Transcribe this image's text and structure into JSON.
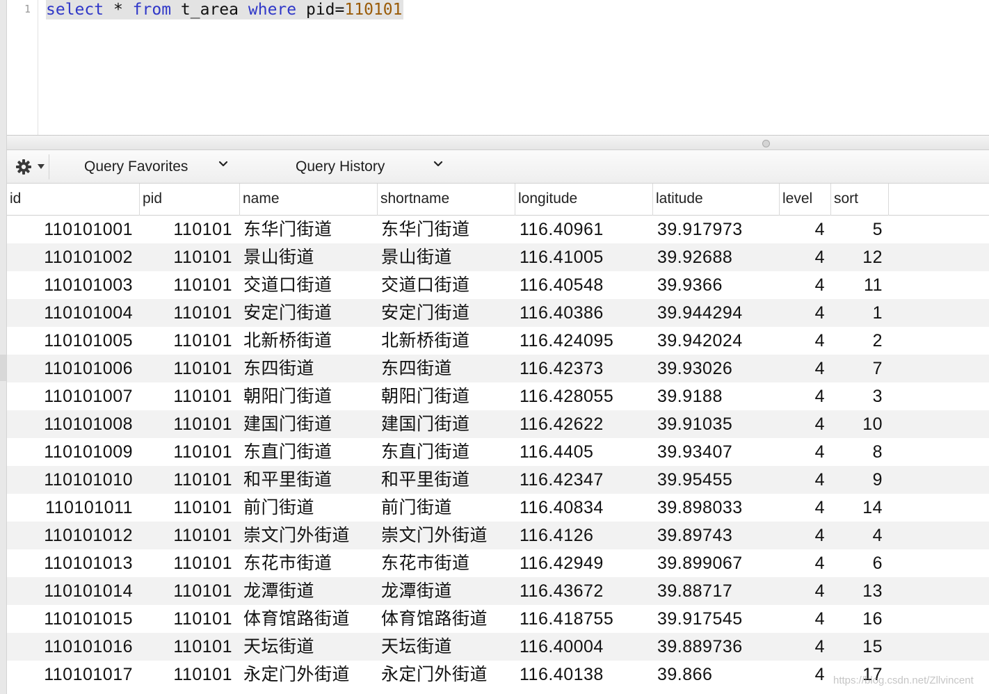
{
  "editor": {
    "line_number": "1",
    "tokens": {
      "select": "select",
      "star": "*",
      "from": "from",
      "table": "t_area",
      "where": "where",
      "column": "pid=",
      "value": "110101"
    }
  },
  "toolbar": {
    "gear_icon": "gear-icon",
    "query_favorites": "Query Favorites",
    "query_history": "Query History"
  },
  "table": {
    "columns": [
      "id",
      "pid",
      "name",
      "shortname",
      "longitude",
      "latitude",
      "level",
      "sort"
    ],
    "rows": [
      [
        "110101001",
        "110101",
        "东华门街道",
        "东华门街道",
        "116.40961",
        "39.917973",
        "4",
        "5"
      ],
      [
        "110101002",
        "110101",
        "景山街道",
        "景山街道",
        "116.41005",
        "39.92688",
        "4",
        "12"
      ],
      [
        "110101003",
        "110101",
        "交道口街道",
        "交道口街道",
        "116.40548",
        "39.9366",
        "4",
        "11"
      ],
      [
        "110101004",
        "110101",
        "安定门街道",
        "安定门街道",
        "116.40386",
        "39.944294",
        "4",
        "1"
      ],
      [
        "110101005",
        "110101",
        "北新桥街道",
        "北新桥街道",
        "116.424095",
        "39.942024",
        "4",
        "2"
      ],
      [
        "110101006",
        "110101",
        "东四街道",
        "东四街道",
        "116.42373",
        "39.93026",
        "4",
        "7"
      ],
      [
        "110101007",
        "110101",
        "朝阳门街道",
        "朝阳门街道",
        "116.428055",
        "39.9188",
        "4",
        "3"
      ],
      [
        "110101008",
        "110101",
        "建国门街道",
        "建国门街道",
        "116.42622",
        "39.91035",
        "4",
        "10"
      ],
      [
        "110101009",
        "110101",
        "东直门街道",
        "东直门街道",
        "116.4405",
        "39.93407",
        "4",
        "8"
      ],
      [
        "110101010",
        "110101",
        "和平里街道",
        "和平里街道",
        "116.42347",
        "39.95455",
        "4",
        "9"
      ],
      [
        "110101011",
        "110101",
        "前门街道",
        "前门街道",
        "116.40834",
        "39.898033",
        "4",
        "14"
      ],
      [
        "110101012",
        "110101",
        "崇文门外街道",
        "崇文门外街道",
        "116.4126",
        "39.89743",
        "4",
        "4"
      ],
      [
        "110101013",
        "110101",
        "东花市街道",
        "东花市街道",
        "116.42949",
        "39.899067",
        "4",
        "6"
      ],
      [
        "110101014",
        "110101",
        "龙潭街道",
        "龙潭街道",
        "116.43672",
        "39.88717",
        "4",
        "13"
      ],
      [
        "110101015",
        "110101",
        "体育馆路街道",
        "体育馆路街道",
        "116.418755",
        "39.917545",
        "4",
        "16"
      ],
      [
        "110101016",
        "110101",
        "天坛街道",
        "天坛街道",
        "116.40004",
        "39.889736",
        "4",
        "15"
      ],
      [
        "110101017",
        "110101",
        "永定门外街道",
        "永定门外街道",
        "116.40138",
        "39.866",
        "4",
        "17"
      ]
    ]
  },
  "watermark": "https://blog.csdn.net/Zllvincent"
}
